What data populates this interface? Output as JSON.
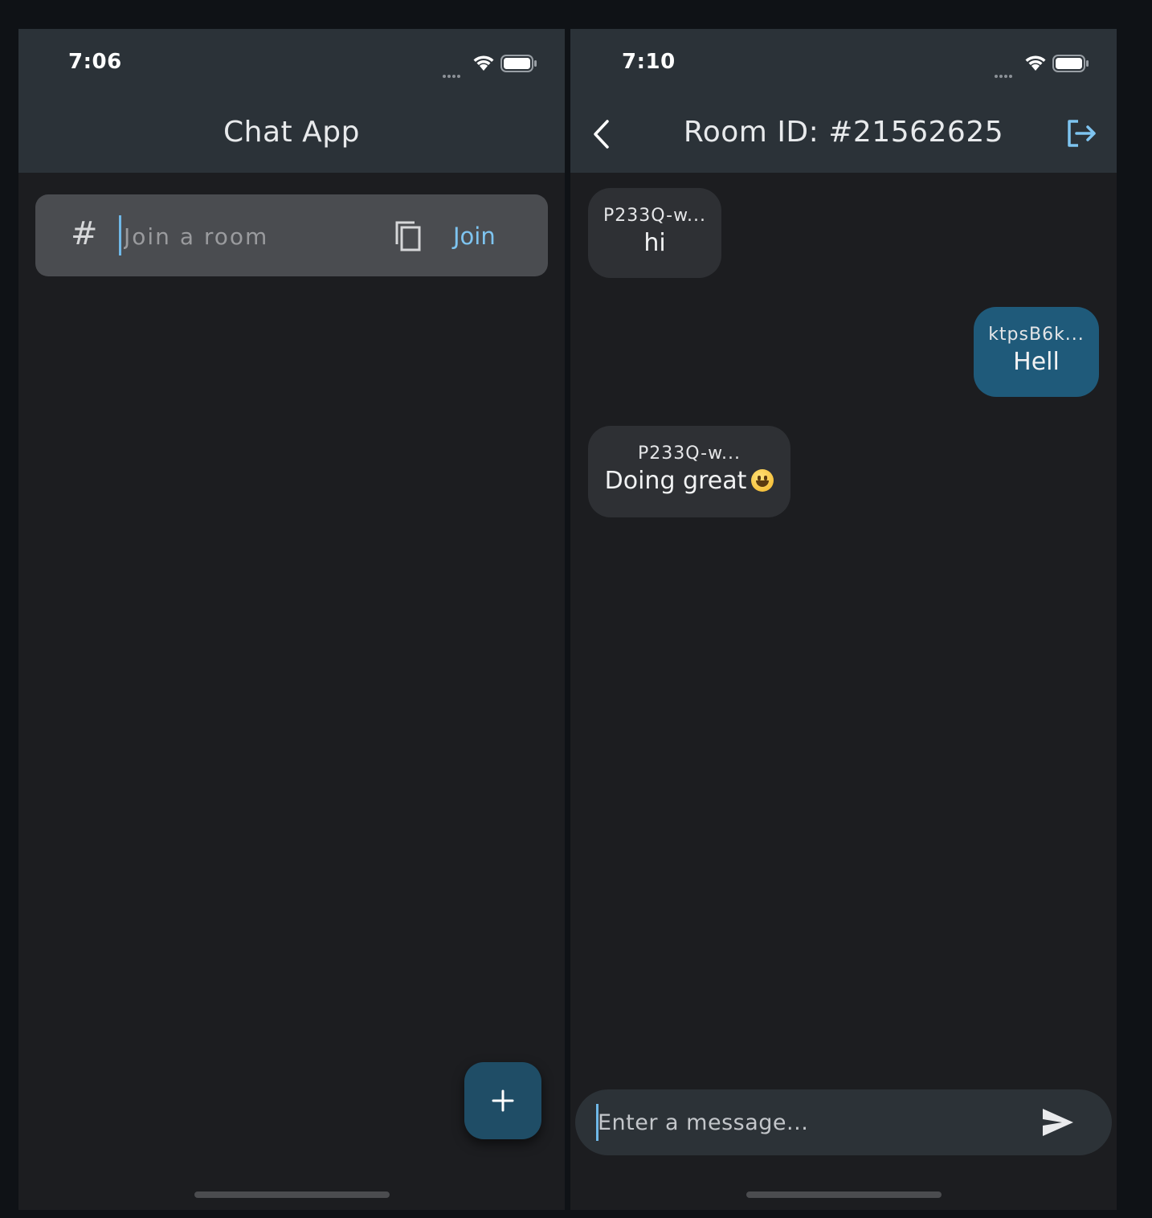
{
  "left": {
    "status_time": "7:06",
    "title": "Chat App",
    "join_placeholder": "Join a room",
    "join_label": "Join",
    "hash_symbol": "#",
    "icons": [
      "hash-icon",
      "copy-icon",
      "plus-icon"
    ]
  },
  "right": {
    "status_time": "7:10",
    "title": "Room ID: #21562625",
    "icons": [
      "back-icon",
      "logout-icon",
      "send-icon"
    ],
    "messages": [
      {
        "sender": "P233Q-w...",
        "text": "hi",
        "side": "left"
      },
      {
        "sender": "ktpsB6k...",
        "text": "Hell",
        "side": "right"
      },
      {
        "sender": "P233Q-w...",
        "text": "Doing great",
        "side": "left",
        "emoji": "grinning-face"
      }
    ],
    "message_placeholder": "Enter a message..."
  },
  "colors": {
    "background": "#1c1d20",
    "appbar": "#2b3238",
    "accent": "#7ec4f0",
    "own_bubble": "#1f5a7a",
    "other_bubble": "#2e3034",
    "fab": "#1f4d66"
  }
}
